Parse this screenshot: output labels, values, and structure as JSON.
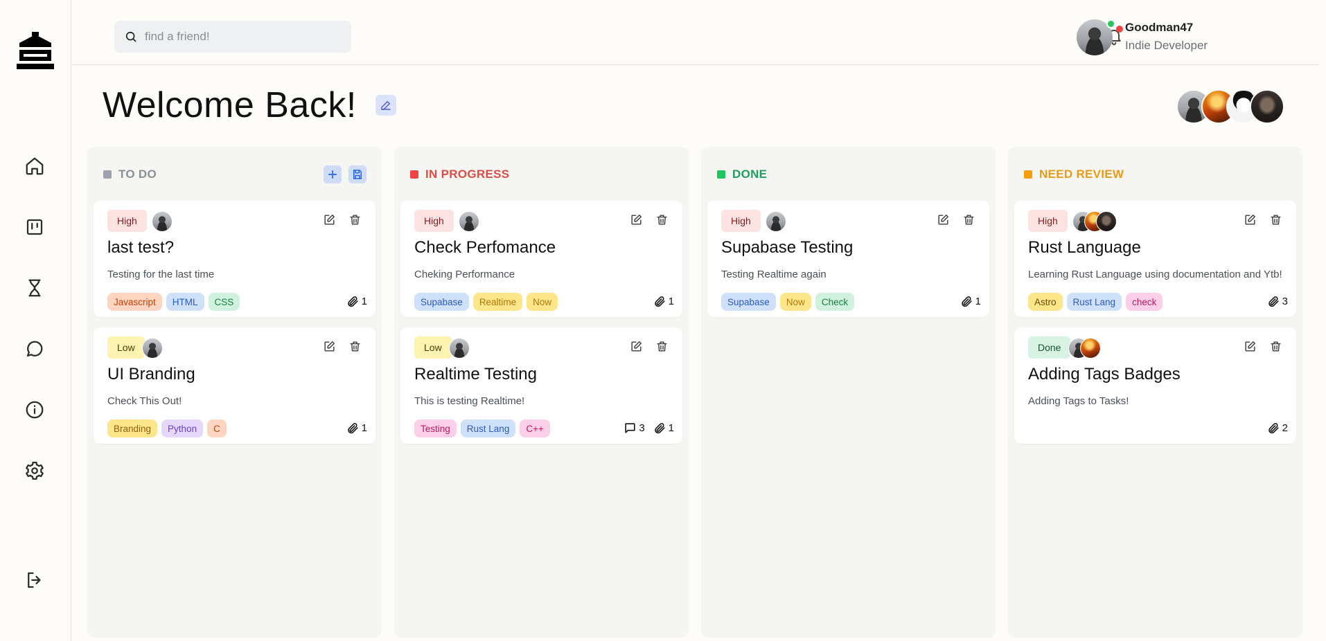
{
  "search": {
    "placeholder": "find a friend!"
  },
  "user": {
    "name": "Goodman47",
    "role": "Indie Developer"
  },
  "page": {
    "title": "Welcome Back!"
  },
  "sidebar": {
    "items": [
      {
        "icon": "home-icon"
      },
      {
        "icon": "kanban-board-icon"
      },
      {
        "icon": "hourglass-icon"
      },
      {
        "icon": "chat-icon"
      },
      {
        "icon": "info-icon"
      },
      {
        "icon": "gear-icon"
      },
      {
        "icon": "logout-icon"
      }
    ]
  },
  "columns": [
    {
      "title": "TO DO",
      "color": "#9ca3af",
      "title_color": "#8b8f96",
      "cards": [
        {
          "priority": "High",
          "title": "last test?",
          "desc": "Testing for the last time",
          "tags": [
            "Javascript",
            "HTML",
            "CSS"
          ],
          "attachments": "1"
        },
        {
          "priority": "Low",
          "title": "UI Branding",
          "desc": "Check This Out!",
          "tags": [
            "Branding",
            "Python",
            "C"
          ],
          "attachments": "1"
        }
      ]
    },
    {
      "title": "IN PROGRESS",
      "color": "#ef4444",
      "title_color": "#dc4b45",
      "cards": [
        {
          "priority": "High",
          "title": "Check Perfomance",
          "desc": "Cheking Performance",
          "tags": [
            "Supabase",
            "Realtime",
            "Now"
          ],
          "attachments": "1"
        },
        {
          "priority": "Low",
          "title": "Realtime Testing",
          "desc": "This is testing Realtime!",
          "tags": [
            "Testing",
            "Rust Lang",
            "C++"
          ],
          "comments": "3",
          "attachments": "1"
        }
      ]
    },
    {
      "title": "DONE",
      "color": "#22c55e",
      "title_color": "#1f9d60",
      "cards": [
        {
          "priority": "High",
          "title": "Supabase Testing",
          "desc": "Testing Realtime again",
          "tags": [
            "Supabase",
            "Now",
            "Check"
          ],
          "attachments": "1"
        }
      ]
    },
    {
      "title": "NEED REVIEW",
      "color": "#f59e0b",
      "title_color": "#ea9a17",
      "cards": [
        {
          "priority": "High",
          "title": "Rust Language",
          "desc": "Learning Rust Language using documentation and Ytb!",
          "tags": [
            "Astro",
            "Rust Lang",
            "check"
          ],
          "attachments": "3"
        },
        {
          "priority": "Done",
          "title": "Adding Tags Badges",
          "desc": "Adding Tags to Tasks!",
          "tags": [],
          "attachments": "2"
        }
      ]
    }
  ]
}
